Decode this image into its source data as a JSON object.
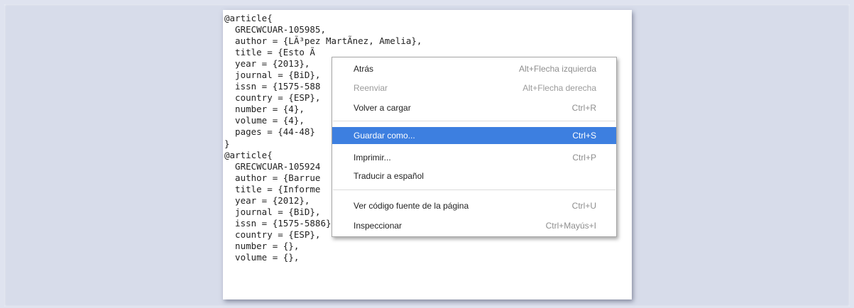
{
  "source_lines": [
    "@article{",
    "  GRECWCUAR-105985,",
    "  author = {LÃ³pez MartÃ­nez, Amelia},",
    "  title = {Esto Ã",
    "  year = {2013},",
    "  journal = {BiD},",
    "  issn = {1575-588",
    "  country = {ESP},",
    "  number = {4},",
    "  volume = {4},",
    "  pages = {44-48}",
    "}",
    "",
    "@article{",
    "  GRECWCUAR-105924",
    "  author = {Barrue",
    "  title = {Informe",
    "  year = {2012},",
    "  journal = {BiD},",
    "  issn = {1575-5886},",
    "  country = {ESP},",
    "  number = {},",
    "  volume = {},"
  ],
  "context_menu": {
    "items": [
      {
        "label": "Atrás",
        "shortcut": "Alt+Flecha izquierda",
        "state": "enabled"
      },
      {
        "label": "Reenviar",
        "shortcut": "Alt+Flecha derecha",
        "state": "disabled"
      },
      {
        "label": "Volver a cargar",
        "shortcut": "Ctrl+R",
        "state": "enabled"
      },
      {
        "label": "Guardar como...",
        "shortcut": "Ctrl+S",
        "state": "highlighted"
      },
      {
        "label": "Imprimir...",
        "shortcut": "Ctrl+P",
        "state": "enabled"
      },
      {
        "label": "Traducir a español",
        "shortcut": "",
        "state": "enabled"
      },
      {
        "label": "Ver código fuente de la página",
        "shortcut": "Ctrl+U",
        "state": "enabled"
      },
      {
        "label": "Inspeccionar",
        "shortcut": "Ctrl+Mayús+I",
        "state": "enabled"
      }
    ]
  },
  "colors": {
    "background": "#dfe3ef",
    "highlight": "#3d7fe0",
    "disabled_text": "#9b9b9b"
  }
}
